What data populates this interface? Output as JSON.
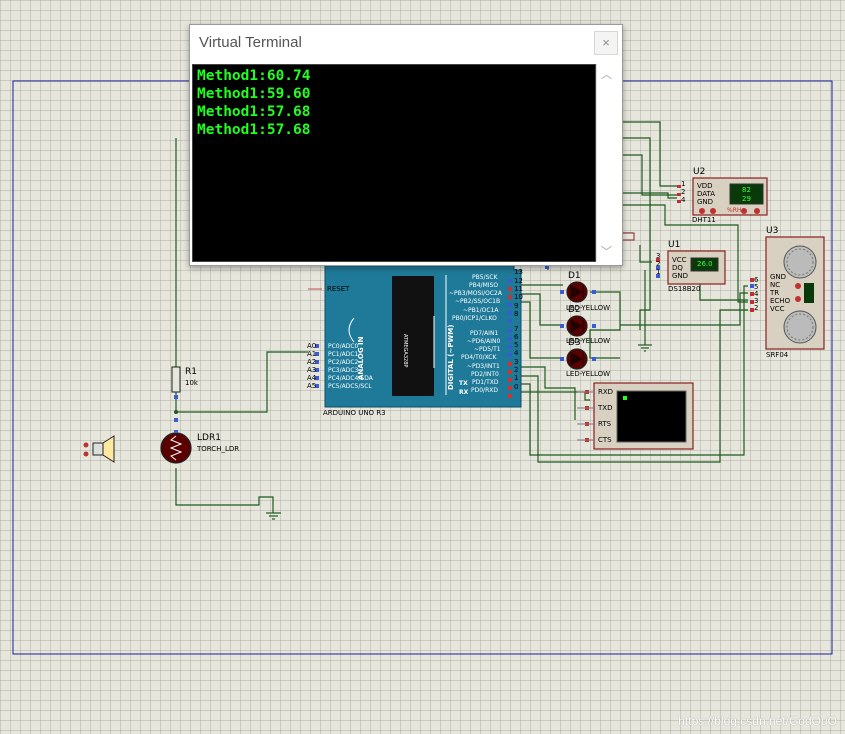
{
  "colors": {
    "grid_bg": "#e6e6dc",
    "wire": "#1e5a1e",
    "border": "#1c1c9a",
    "arduino": "#1f7a99",
    "terminal_text": "#20ff20"
  },
  "terminal": {
    "title": "Virtual Terminal",
    "close_label": "×",
    "lines": [
      "Method1:60.74",
      "Method1:59.60",
      "Method1:57.68",
      "Method1:57.68"
    ],
    "scroll_up": "︿",
    "scroll_down": "﹀"
  },
  "arduino": {
    "name": "ARDUINO UNO R3",
    "reset": "RESET",
    "analog_title": "ANALOG IN",
    "digital_title": "DIGITAL (~PWM)",
    "analog_pins": [
      "A0",
      "A1",
      "A2",
      "A3",
      "A4",
      "A5"
    ],
    "analog_pin_names": [
      "PC0/ADC0",
      "PC1/ADC1",
      "PC2/ADC2",
      "PC3/ADC3",
      "PC4/ADC4/SDA",
      "PC5/ADC5/SCL"
    ],
    "digital_pin_names": [
      "PB5/SCK",
      "PB4/MISO",
      "~PB3/MOSI/OC2A",
      "~PB2/SS/OC1B",
      "~PB1/OC1A",
      "PB0/ICP1/CLKO",
      "PD7/AIN1",
      "~PD6/AIN0",
      "~PD5/T1",
      "PD4/T0/XCK",
      "~PD3/INT1",
      "PD2/INT0",
      "PD1/TXD",
      "PD0/RXD"
    ],
    "digital_pin_nums": [
      "13",
      "12",
      "11",
      "10",
      "9",
      "8",
      "7",
      "6",
      "5",
      "4",
      "3",
      "2",
      "1",
      "0"
    ],
    "tx": "TX",
    "rx": "RX",
    "chip": "ATMEGA328P"
  },
  "leds": [
    {
      "ref": "D1",
      "type": "LED-YELLOW"
    },
    {
      "ref": "D2",
      "type": "LED-YELLOW"
    },
    {
      "ref": "D3",
      "type": "LED-YELLOW"
    }
  ],
  "dht11": {
    "ref": "U2",
    "name": "DHT11",
    "pins": [
      "VDD",
      "DATA",
      "GND"
    ],
    "pin_nums": [
      "1",
      "2",
      "4"
    ],
    "reading_top": "82",
    "reading_bottom": "29",
    "rh": "%RH"
  },
  "ds18b20": {
    "ref": "U1",
    "name": "DS18B20",
    "pins": [
      "VCC",
      "DQ",
      "GND"
    ],
    "pin_nums": [
      "3",
      "2",
      "1"
    ],
    "reading": "26.0"
  },
  "srf04": {
    "ref": "U3",
    "name": "SRF04",
    "pins": [
      "GND",
      "NC",
      "TR",
      "ECHO",
      "VCC"
    ],
    "pin_nums": [
      "6",
      "5",
      "4",
      "3",
      "2"
    ]
  },
  "resistor": {
    "ref": "R1",
    "value": "10k"
  },
  "ldr": {
    "ref": "LDR1",
    "type": "TORCH_LDR"
  },
  "serial_term": {
    "pins": [
      "RXD",
      "TXD",
      "RTS",
      "CTS"
    ]
  },
  "watermark": "https://blog.csdn.net/GodOuO"
}
